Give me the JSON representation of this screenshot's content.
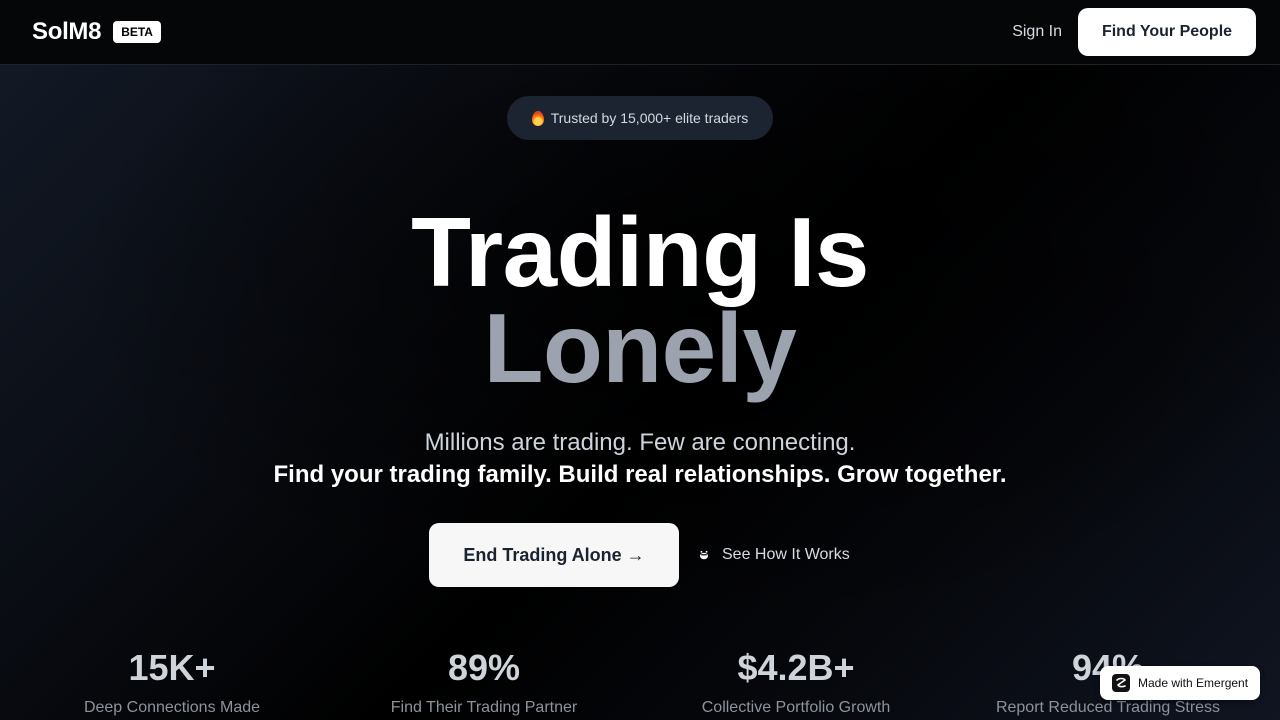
{
  "header": {
    "logo": "SolM8",
    "badge": "BETA",
    "sign_in": "Sign In",
    "cta": "Find Your People"
  },
  "hero": {
    "trust_pill": "Trusted by 15,000+ elite traders",
    "title_line1": "Trading Is",
    "title_line2": "Lonely",
    "subtitle": "Millions are trading. Few are connecting.",
    "tagline": "Find your trading family. Build real relationships. Grow together.",
    "primary_cta": "End Trading Alone →",
    "secondary_cta": "See How It Works"
  },
  "stats": [
    {
      "value": "15K+",
      "label": "Deep Connections Made"
    },
    {
      "value": "89%",
      "label": "Find Their Trading Partner"
    },
    {
      "value": "$4.2B+",
      "label": "Collective Portfolio Growth"
    },
    {
      "value": "94%",
      "label": "Report Reduced Trading Stress"
    }
  ],
  "badge": {
    "label": "Made with Emergent"
  },
  "icons": {
    "fire": "fire-icon",
    "play": "play-icon",
    "emergent": "emergent-logo-icon"
  },
  "colors": {
    "background": "#000000",
    "accent_white": "#ffffff",
    "muted_title": "#9ca3af",
    "pill_bg": "#1c2431"
  }
}
